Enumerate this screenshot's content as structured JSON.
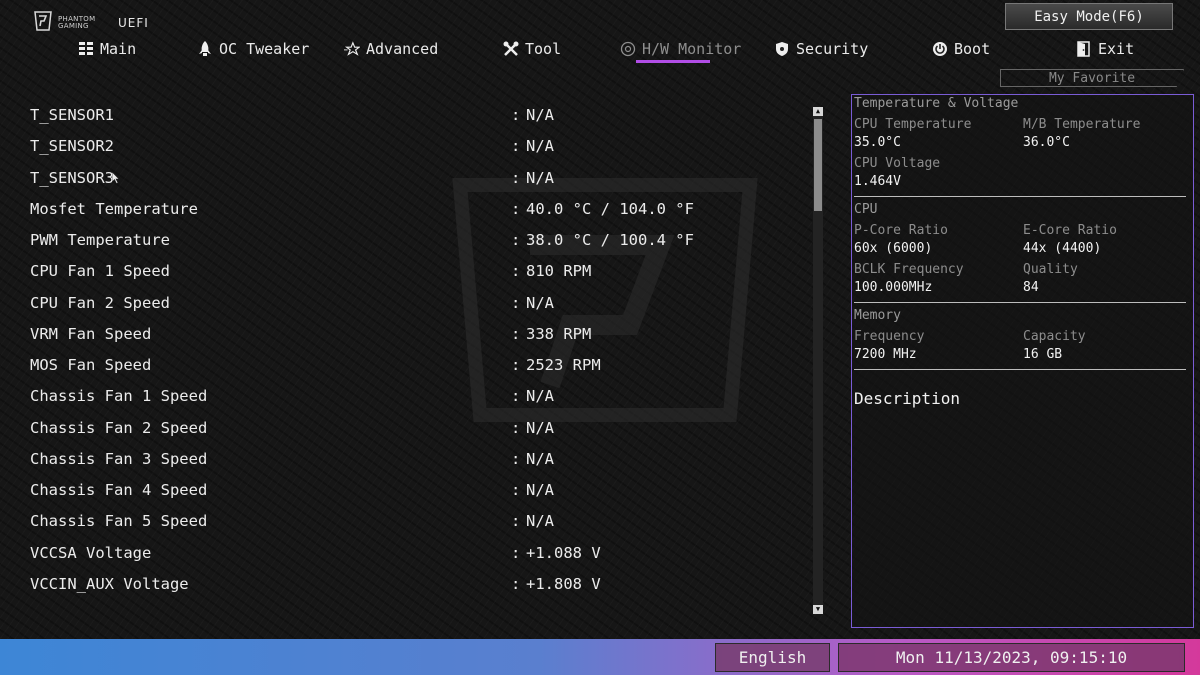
{
  "header": {
    "brand_sub": "PHANTOM\nGAMING",
    "brand_uefi": "UEFI",
    "easy_mode_label": "Easy Mode(F6)",
    "my_favorite_label": "My Favorite"
  },
  "nav": {
    "items": [
      {
        "label": "Main",
        "icon": "grid-icon"
      },
      {
        "label": "OC Tweaker",
        "icon": "rocket-icon"
      },
      {
        "label": "Advanced",
        "icon": "star-icon"
      },
      {
        "label": "Tool",
        "icon": "tools-icon"
      },
      {
        "label": "H/W Monitor",
        "icon": "monitor-icon",
        "active": true
      },
      {
        "label": "Security",
        "icon": "shield-icon"
      },
      {
        "label": "Boot",
        "icon": "power-icon"
      },
      {
        "label": "Exit",
        "icon": "exit-door-icon"
      }
    ]
  },
  "monitor": {
    "rows": [
      {
        "label": "T_SENSOR1",
        "value": "N/A"
      },
      {
        "label": "T_SENSOR2",
        "value": "N/A"
      },
      {
        "label": "T_SENSOR3",
        "value": "N/A"
      },
      {
        "label": "Mosfet Temperature",
        "value": "40.0 °C / 104.0 °F"
      },
      {
        "label": "PWM Temperature",
        "value": "38.0 °C / 100.4 °F"
      },
      {
        "label": "CPU Fan 1 Speed",
        "value": "810 RPM"
      },
      {
        "label": "CPU Fan 2 Speed",
        "value": "N/A"
      },
      {
        "label": "VRM Fan Speed",
        "value": "338 RPM"
      },
      {
        "label": "MOS Fan Speed",
        "value": "2523 RPM"
      },
      {
        "label": "Chassis Fan 1 Speed",
        "value": "N/A"
      },
      {
        "label": "Chassis Fan 2 Speed",
        "value": "N/A"
      },
      {
        "label": "Chassis Fan 3 Speed",
        "value": "N/A"
      },
      {
        "label": "Chassis Fan 4 Speed",
        "value": "N/A"
      },
      {
        "label": "Chassis Fan 5 Speed",
        "value": "N/A"
      },
      {
        "label": "VCCSA Voltage",
        "value": "+1.088 V"
      },
      {
        "label": "VCCIN_AUX Voltage",
        "value": "+1.808 V"
      }
    ],
    "separator": ":"
  },
  "panel": {
    "temp_voltage": {
      "title": "Temperature & Voltage",
      "cpu_temp_label": "CPU Temperature",
      "cpu_temp_value": "35.0°C",
      "mb_temp_label": "M/B Temperature",
      "mb_temp_value": "36.0°C",
      "cpu_voltage_label": "CPU Voltage",
      "cpu_voltage_value": "1.464V"
    },
    "cpu": {
      "title": "CPU",
      "pcore_label": "P-Core Ratio",
      "pcore_value": "60x (6000)",
      "ecore_label": "E-Core Ratio",
      "ecore_value": "44x (4400)",
      "bclk_label": "BCLK Frequency",
      "bclk_value": "100.000MHz",
      "quality_label": "Quality",
      "quality_value": "84"
    },
    "memory": {
      "title": "Memory",
      "freq_label": "Frequency",
      "freq_value": "7200 MHz",
      "capacity_label": "Capacity",
      "capacity_value": "16 GB"
    },
    "description_title": "Description"
  },
  "footer": {
    "language": "English",
    "datetime": "Mon 11/13/2023, 09:15:10"
  },
  "colors": {
    "accent_purple": "#b14de6",
    "panel_border": "#7a5cd6"
  }
}
